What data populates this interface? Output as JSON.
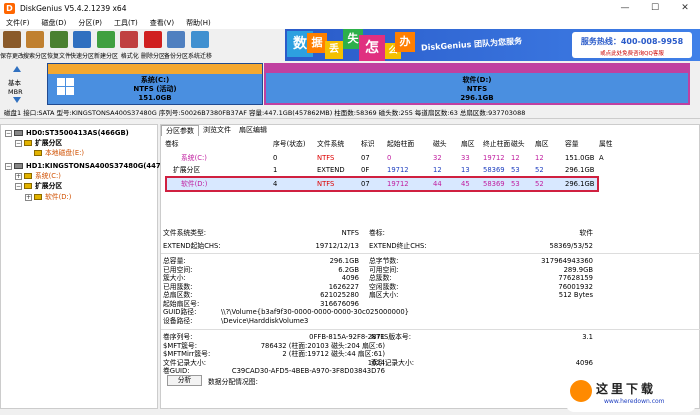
{
  "window": {
    "title": "DiskGenius V5.4.2.1239 x64",
    "minimize": "—",
    "maximize": "☐",
    "close": "✕"
  },
  "menu": [
    "文件(F)",
    "磁盘(D)",
    "分区(P)",
    "工具(T)",
    "查看(V)",
    "帮助(H)"
  ],
  "toolbar": [
    {
      "label": "保存更改",
      "color": "#8a5a2a"
    },
    {
      "label": "搜索分区",
      "color": "#c08030"
    },
    {
      "label": "恢复文件",
      "color": "#4a8030"
    },
    {
      "label": "快速分区",
      "color": "#3070c0"
    },
    {
      "label": "新建分区",
      "color": "#40a040"
    },
    {
      "label": "格式化",
      "color": "#c04040"
    },
    {
      "label": "删除分区",
      "color": "#d02020"
    },
    {
      "label": "备份分区",
      "color": "#5080c0"
    },
    {
      "label": "系统迁移",
      "color": "#4090d0"
    }
  ],
  "banner": {
    "words": [
      "数",
      "据",
      "丢",
      "失",
      "怎",
      "么",
      "办"
    ],
    "tagline": "DiskGenius 团队为您服务",
    "phone": "服务热线：400-008-9958",
    "sub": "或点此处免费咨询QQ客服"
  },
  "diskmap": {
    "label1": "基本",
    "label2": "MBR",
    "c": {
      "name": "系统(C:)",
      "fs": "NTFS (活动)",
      "size": "151.0GB"
    },
    "d": {
      "name": "软件(D:)",
      "fs": "NTFS",
      "size": "296.1GB"
    }
  },
  "infobar": "磁盘1 接口:SATA  型号:KINGSTONSA400S37480G  序列号:50026B7380FB37AF  容量:447.1GB(457862MB)  柱面数:58369  磁头数:255  每道扇区数:63  总扇区数:937703088",
  "tree": [
    {
      "indent": 0,
      "box": "−",
      "icon": "disk",
      "text": "HD0:ST3500413AS(466GB)",
      "cls": "",
      "bold": true
    },
    {
      "indent": 1,
      "box": "−",
      "icon": "part",
      "text": "扩展分区",
      "cls": "",
      "bold": true
    },
    {
      "indent": 2,
      "box": "",
      "icon": "part",
      "text": "本地磁盘(E:)",
      "cls": "red",
      "bold": false
    },
    {
      "indent": 0,
      "box": "−",
      "icon": "disk",
      "text": "HD1:KINGSTONSA400S37480G(447GB)",
      "cls": "",
      "bold": true
    },
    {
      "indent": 1,
      "box": "+",
      "icon": "part",
      "text": "系统(C:)",
      "cls": "red",
      "bold": false
    },
    {
      "indent": 1,
      "box": "−",
      "icon": "part",
      "text": "扩展分区",
      "cls": "",
      "bold": true
    },
    {
      "indent": 2,
      "box": "+",
      "icon": "part",
      "text": "软件(D:)",
      "cls": "red",
      "bold": false
    }
  ],
  "tabs": [
    "分区参数",
    "浏览文件",
    "扇区编辑"
  ],
  "table": {
    "headers": [
      "卷标",
      "序号(状态)",
      "文件系统",
      "标识",
      "起始柱面",
      "磁头",
      "扇区",
      "终止柱面",
      "磁头",
      "扇区",
      "容量",
      "属性"
    ],
    "rows": [
      {
        "label": "系统(C:)",
        "cls": "mag",
        "cells": [
          "0",
          "NTFS",
          "07",
          "0",
          "32",
          "33",
          "19712",
          "12",
          "12",
          "151.0GB",
          "A"
        ]
      },
      {
        "label": "扩展分区",
        "cls": "",
        "cells": [
          "1",
          "EXTEND",
          "0F",
          "19712",
          "12",
          "13",
          "58369",
          "53",
          "52",
          "296.1GB",
          ""
        ]
      },
      {
        "label": "软件(D:)",
        "cls": "mag",
        "cells": [
          "4",
          "NTFS",
          "07",
          "19712",
          "44",
          "45",
          "58369",
          "53",
          "52",
          "296.1GB",
          ""
        ]
      }
    ]
  },
  "details": {
    "fs_type_label": "文件系统类型:",
    "fs_type": "NTFS",
    "vol_label_label": "卷标:",
    "vol_label": "软件",
    "ext_start_label": "EXTEND起始CHS:",
    "ext_start": "19712/12/13",
    "ext_end_label": "EXTEND终止CHS:",
    "ext_end": "58369/53/52",
    "left": [
      [
        "总容量:",
        "296.1GB"
      ],
      [
        "已用空间:",
        "6.2GB"
      ],
      [
        "簇大小:",
        "4096"
      ],
      [
        "已用簇数:",
        "1626227"
      ],
      [
        "总扇区数:",
        "621025280"
      ],
      [
        "起始扇区号:",
        "316676096"
      ],
      [
        "GUID路径:",
        "\\\\?\\Volume{b3af9f30-0000-0000-0000-30c025000000}"
      ],
      [
        "设备路径:",
        "\\Device\\HarddiskVolume3"
      ]
    ],
    "right": [
      [
        "总字节数:",
        "317964943360"
      ],
      [
        "可用空间:",
        "289.9GB"
      ],
      [
        "总簇数:",
        "77628159"
      ],
      [
        "空闲簇数:",
        "76001932"
      ],
      [
        "扇区大小:",
        "512 Bytes"
      ]
    ],
    "lower_left": [
      [
        "卷序列号:",
        "0FFB-815A-92F8-2871"
      ],
      [
        "$MFT簇号:",
        "786432 (柱面:20103 磁头:204 扇区:6)"
      ],
      [
        "$MFTMirr簇号:",
        "2 (柱面:19712 磁头:44 扇区:61)"
      ],
      [
        "文件记录大小:",
        "1024"
      ],
      [
        "卷GUID:",
        "C39CAD30-AFD5-4BEB-A970-3F8D03843D76"
      ]
    ],
    "lower_right": [
      [
        "NTFS版本号:",
        "3.1"
      ],
      [
        "",
        ""
      ],
      [
        "",
        ""
      ],
      [
        "索引记录大小:",
        "4096"
      ]
    ]
  },
  "analyze_label": "分析",
  "analyze_note": "数据分配情况图:",
  "watermark": {
    "text": "这里下载",
    "url": "www.heredown.com"
  }
}
